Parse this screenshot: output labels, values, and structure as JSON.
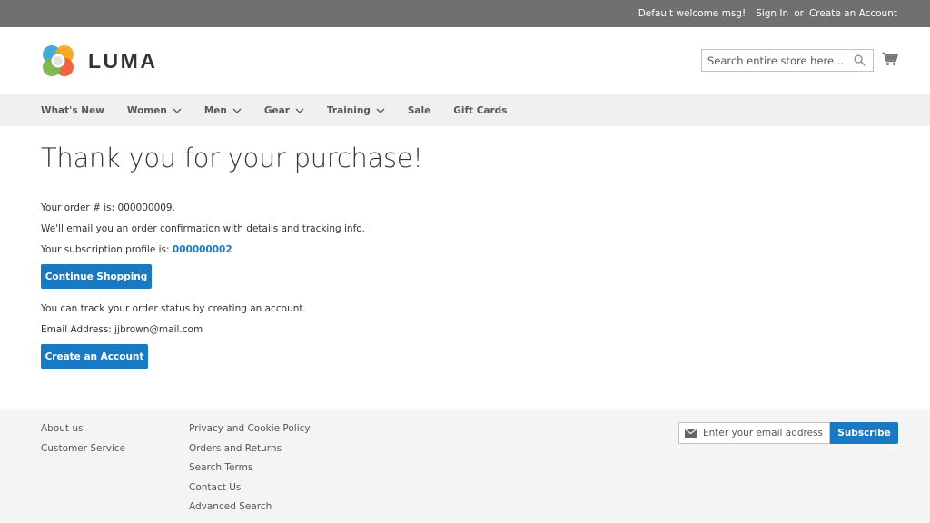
{
  "topbar": {
    "welcome": "Default welcome msg!",
    "sign_in": "Sign In",
    "or": "or",
    "create_account": "Create an Account"
  },
  "header": {
    "logo_text": "LUMA",
    "logo_icon": "luma-logo-icon",
    "search_placeholder": "Search entire store here...",
    "search_icon": "search-icon",
    "cart_icon": "cart-icon"
  },
  "nav": {
    "items": [
      {
        "label": "What's New",
        "dropdown": false
      },
      {
        "label": "Women",
        "dropdown": true
      },
      {
        "label": "Men",
        "dropdown": true
      },
      {
        "label": "Gear",
        "dropdown": true
      },
      {
        "label": "Training",
        "dropdown": true
      },
      {
        "label": "Sale",
        "dropdown": false
      },
      {
        "label": "Gift Cards",
        "dropdown": false
      }
    ]
  },
  "main": {
    "title": "Thank you for your purchase!",
    "order_line": "Your order # is: 000000009.",
    "email_line": "We'll email you an order confirmation with details and tracking info.",
    "subscription_prefix": "Your subscription profile is: ",
    "subscription_id": "000000002",
    "continue_button": "Continue Shopping",
    "track_line": "You can track your order status by creating an account.",
    "email_address_line": "Email Address: jjbrown@mail.com",
    "create_account_button": "Create an Account"
  },
  "footer": {
    "col1": [
      "About us",
      "Customer Service"
    ],
    "col2": [
      "Privacy and Cookie Policy",
      "Orders and Returns",
      "Search Terms",
      "Contact Us",
      "Advanced Search"
    ],
    "newsletter_placeholder": "Enter your email address",
    "subscribe_button": "Subscribe",
    "mail_icon": "envelope-icon"
  },
  "colors": {
    "topbar": "#6e716e",
    "nav_bg": "#f0f0f0",
    "primary": "#1979c3",
    "footer_bg": "#f4f4f4"
  }
}
